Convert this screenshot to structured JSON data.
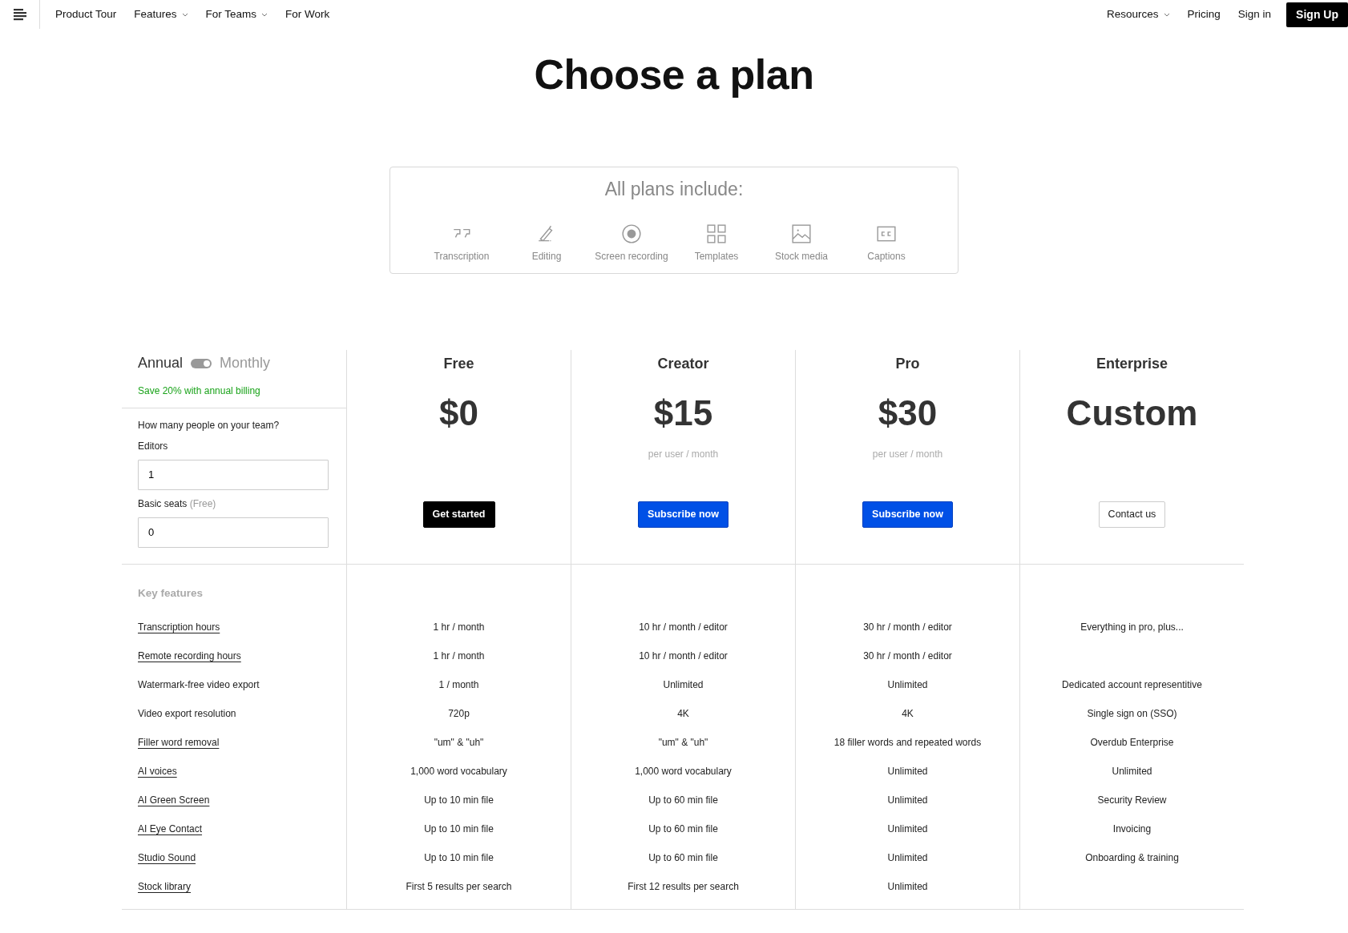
{
  "nav": {
    "left": [
      {
        "label": "Product Tour",
        "dropdown": false
      },
      {
        "label": "Features",
        "dropdown": true
      },
      {
        "label": "For Teams",
        "dropdown": true
      },
      {
        "label": "For Work",
        "dropdown": false
      }
    ],
    "right": [
      {
        "label": "Resources",
        "dropdown": true
      },
      {
        "label": "Pricing",
        "dropdown": false
      },
      {
        "label": "Sign in",
        "dropdown": false
      }
    ],
    "cta": "Sign Up"
  },
  "title": "Choose a plan",
  "includes": {
    "heading": "All plans include:",
    "items": [
      {
        "kind": "quote",
        "label": "Transcription"
      },
      {
        "kind": "pen",
        "label": "Editing"
      },
      {
        "kind": "record",
        "label": "Screen recording"
      },
      {
        "kind": "grid",
        "label": "Templates"
      },
      {
        "kind": "image",
        "label": "Stock media"
      },
      {
        "kind": "cc",
        "label": "Captions"
      }
    ]
  },
  "billing": {
    "annual": "Annual",
    "monthly": "Monthly",
    "annual_selected": true,
    "note": "Save 20% with annual billing"
  },
  "team": {
    "question": "How many people on your team?",
    "fields": [
      {
        "label": "Editors",
        "value": "1"
      },
      {
        "label": "Basic seats",
        "hint": "(Free)",
        "value": "0"
      }
    ]
  },
  "plans": [
    {
      "name": "Free",
      "price": "$0",
      "button": {
        "label": "Get started",
        "kind": "dark"
      }
    },
    {
      "name": "Creator",
      "price": "$15",
      "unit": "per user / month",
      "button": {
        "label": "Subscribe now",
        "kind": "primary"
      }
    },
    {
      "name": "Pro",
      "price": "$30",
      "unit": "per user / month",
      "button": {
        "label": "Subscribe now",
        "kind": "primary"
      }
    },
    {
      "name": "Enterprise",
      "price": "Custom",
      "button": {
        "label": "Contact us",
        "kind": "outline"
      }
    }
  ],
  "features": {
    "heading": "Key features",
    "rows": [
      {
        "label": "Transcription hours",
        "underlined": true,
        "values": [
          "1 hr / month",
          "10 hr / month / editor",
          "30 hr / month / editor",
          "Everything in pro, plus..."
        ]
      },
      {
        "label": "Remote recording hours",
        "underlined": true,
        "values": [
          "1 hr / month",
          "10 hr / month / editor",
          "30 hr / month / editor"
        ]
      },
      {
        "label": "Watermark-free video export",
        "underlined": false,
        "values": [
          "1 / month",
          "Unlimited",
          "Unlimited",
          "Dedicated account representitive"
        ]
      },
      {
        "label": "Video export resolution",
        "underlined": false,
        "values": [
          "720p",
          "4K",
          "4K",
          "Single sign on (SSO)"
        ]
      },
      {
        "label": "Filler word removal",
        "underlined": true,
        "values": [
          "\"um\" & \"uh\"",
          "\"um\" & \"uh\"",
          "18 filler words and repeated words",
          "Overdub Enterprise"
        ]
      },
      {
        "label": "AI voices",
        "underlined": true,
        "values": [
          "1,000 word vocabulary",
          "1,000 word vocabulary",
          "Unlimited",
          "Unlimited"
        ]
      },
      {
        "label": "AI Green Screen",
        "underlined": true,
        "values": [
          "Up to 10 min file",
          "Up to 60 min file",
          "Unlimited",
          "Security Review"
        ]
      },
      {
        "label": "AI Eye Contact",
        "underlined": true,
        "values": [
          "Up to 10 min file",
          "Up to 60 min file",
          "Unlimited",
          "Invoicing"
        ]
      },
      {
        "label": "Studio Sound",
        "underlined": true,
        "values": [
          "Up to 10 min file",
          "Up to 60 min file",
          "Unlimited",
          "Onboarding & training"
        ]
      },
      {
        "label": "Stock library",
        "underlined": true,
        "values": [
          "First 5 results per search",
          "First 12 results per search",
          "Unlimited"
        ]
      }
    ]
  }
}
